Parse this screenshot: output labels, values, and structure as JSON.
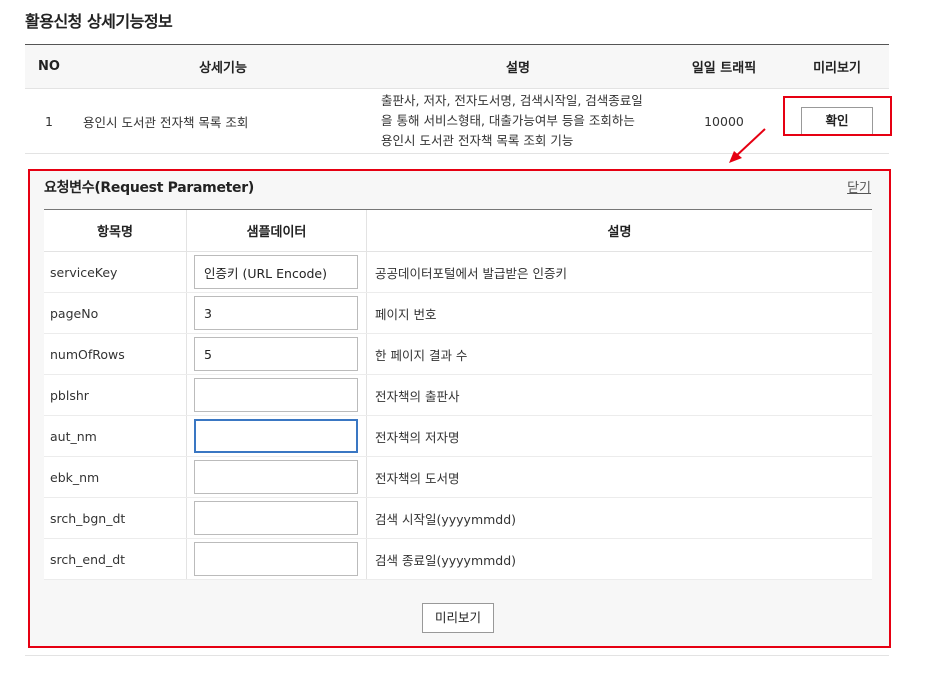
{
  "page": {
    "title": "활용신청 상세기능정보"
  },
  "top_table": {
    "headers": {
      "no": "NO",
      "feature": "상세기능",
      "desc": "설명",
      "traffic": "일일 트래픽",
      "preview": "미리보기"
    },
    "row": {
      "no": "1",
      "feature": "용인시 도서관 전자책 목록 조회",
      "desc_lines": [
        "출판사, 저자, 전자도서명, 검색시작일, 검색종료일",
        "을 통해 서비스형태, 대출가능여부 등을 조회하는",
        "용인시 도서관 전자책 목록 조회 기능"
      ],
      "traffic": "10000",
      "button": "확인"
    }
  },
  "panel": {
    "title": "요청변수(Request Parameter)",
    "close": "닫기",
    "headers": {
      "name": "항목명",
      "sample": "샘플데이터",
      "desc": "설명"
    },
    "rows": [
      {
        "name": "serviceKey",
        "value": "인증키 (URL Encode)",
        "desc": "공공데이터포털에서 발급받은 인증키"
      },
      {
        "name": "pageNo",
        "value": "3",
        "desc": "페이지 번호"
      },
      {
        "name": "numOfRows",
        "value": "5",
        "desc": "한 페이지 결과 수"
      },
      {
        "name": "pblshr",
        "value": "",
        "desc": "전자책의 출판사"
      },
      {
        "name": "aut_nm",
        "value": "",
        "desc": "전자책의 저자명"
      },
      {
        "name": "ebk_nm",
        "value": "",
        "desc": "전자책의 도서명"
      },
      {
        "name": "srch_bgn_dt",
        "value": "",
        "desc": "검색 시작일(yyyymmdd)"
      },
      {
        "name": "srch_end_dt",
        "value": "",
        "desc": "검색 종료일(yyyymmdd)"
      }
    ],
    "preview_button": "미리보기"
  },
  "colors": {
    "highlight": "#e60012",
    "focus": "#3a77c3"
  }
}
